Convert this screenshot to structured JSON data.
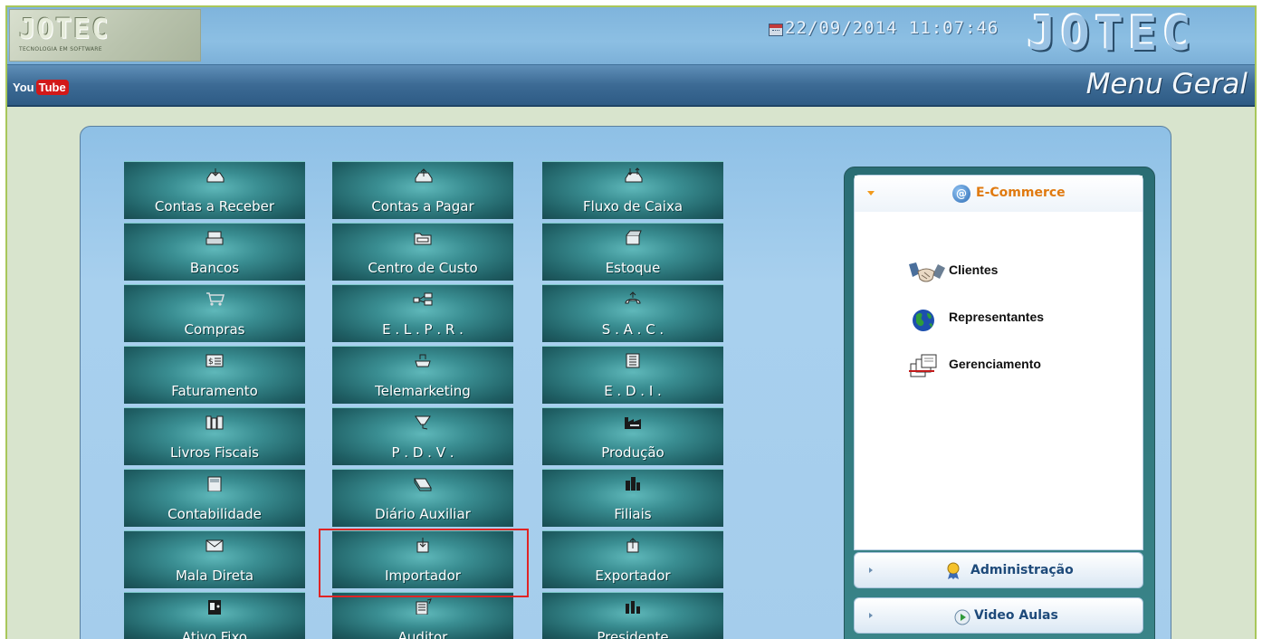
{
  "header": {
    "logo_text": "JOTEC",
    "logo_sub": "TECNOLOGIA EM SOFTWARE",
    "datetime": "22/09/2014  11:07:46",
    "brand_text": "JOTEC"
  },
  "subbar": {
    "youtube_you": "You",
    "youtube_tube": "Tube",
    "title": "Menu Geral"
  },
  "modules": [
    {
      "label": "Contas a Receber",
      "icon": "inbox-tray-icon"
    },
    {
      "label": "Contas a Pagar",
      "icon": "outbox-tray-icon"
    },
    {
      "label": "Fluxo de Caixa",
      "icon": "tray-arrows-icon"
    },
    {
      "label": "Bancos",
      "icon": "cash-register-icon"
    },
    {
      "label": "Centro de Custo",
      "icon": "folder-drawer-icon"
    },
    {
      "label": "Estoque",
      "icon": "open-box-icon"
    },
    {
      "label": "Compras",
      "icon": "shopping-cart-icon"
    },
    {
      "label": "E . L . P . R .",
      "icon": "network-nodes-icon"
    },
    {
      "label": "S . A . C .",
      "icon": "telephone-icon"
    },
    {
      "label": "Faturamento",
      "icon": "invoice-icon"
    },
    {
      "label": "Telemarketing",
      "icon": "phone-tray-icon"
    },
    {
      "label": "E . D . I .",
      "icon": "document-list-icon"
    },
    {
      "label": "Livros Fiscais",
      "icon": "books-icon"
    },
    {
      "label": "P . D . V .",
      "icon": "barcode-scanner-icon"
    },
    {
      "label": "Produção",
      "icon": "factory-icon"
    },
    {
      "label": "Contabilidade",
      "icon": "calculator-icon"
    },
    {
      "label": "Diário Auxiliar",
      "icon": "notebook-icon"
    },
    {
      "label": "Filiais",
      "icon": "buildings-icon"
    },
    {
      "label": "Mala Direta",
      "icon": "envelope-icon"
    },
    {
      "label": "Importador",
      "icon": "import-icon"
    },
    {
      "label": "Exportador",
      "icon": "export-icon"
    },
    {
      "label": "Ativo Fixo",
      "icon": "safe-icon"
    },
    {
      "label": "Auditor",
      "icon": "audit-icon"
    },
    {
      "label": "Presidente",
      "icon": "bar-chart-icon"
    }
  ],
  "sidebar": {
    "ecommerce_title": "E-Commerce",
    "items": [
      {
        "label": "Clientes",
        "icon": "handshake-icon"
      },
      {
        "label": "Representantes",
        "icon": "globe-icon"
      },
      {
        "label": "Gerenciamento",
        "icon": "stacked-documents-icon"
      }
    ],
    "administracao": "Administração",
    "video_aulas": "Video Aulas"
  },
  "colors": {
    "button_teal": "#2f7d82",
    "highlight_red": "#e02424",
    "ecommerce_orange": "#e07a10",
    "accordion_blue": "#1e4a7a"
  }
}
